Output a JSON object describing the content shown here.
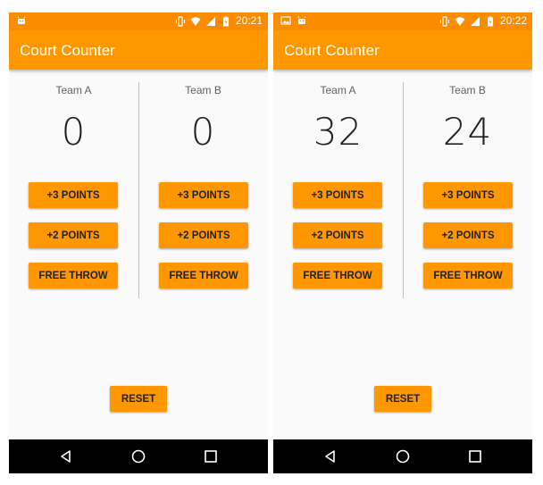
{
  "screens": [
    {
      "status_time": "20:21",
      "app_title": "Court Counter",
      "team_a": {
        "name": "Team A",
        "score": "0"
      },
      "team_b": {
        "name": "Team B",
        "score": "0"
      },
      "buttons": {
        "three": "+3 POINTS",
        "two": "+2 POINTS",
        "free": "FREE THROW"
      },
      "reset_label": "RESET"
    },
    {
      "status_time": "20:22",
      "app_title": "Court Counter",
      "team_a": {
        "name": "Team A",
        "score": "32"
      },
      "team_b": {
        "name": "Team B",
        "score": "24"
      },
      "buttons": {
        "three": "+3 POINTS",
        "two": "+2 POINTS",
        "free": "FREE THROW"
      },
      "reset_label": "RESET"
    }
  ],
  "colors": {
    "status_bar": "#fb8c00",
    "app_bar": "#ff9800",
    "button": "#ff9800",
    "background": "#fafafa",
    "nav_bar": "#000000"
  },
  "icons": {
    "status_left_screen1": [
      "android-icon"
    ],
    "status_left_screen2": [
      "image-icon",
      "android-icon"
    ],
    "status_right": [
      "vibrate-icon",
      "wifi-icon",
      "signal-icon",
      "battery-icon"
    ],
    "nav": [
      "back-icon",
      "home-icon",
      "recent-apps-icon"
    ]
  }
}
